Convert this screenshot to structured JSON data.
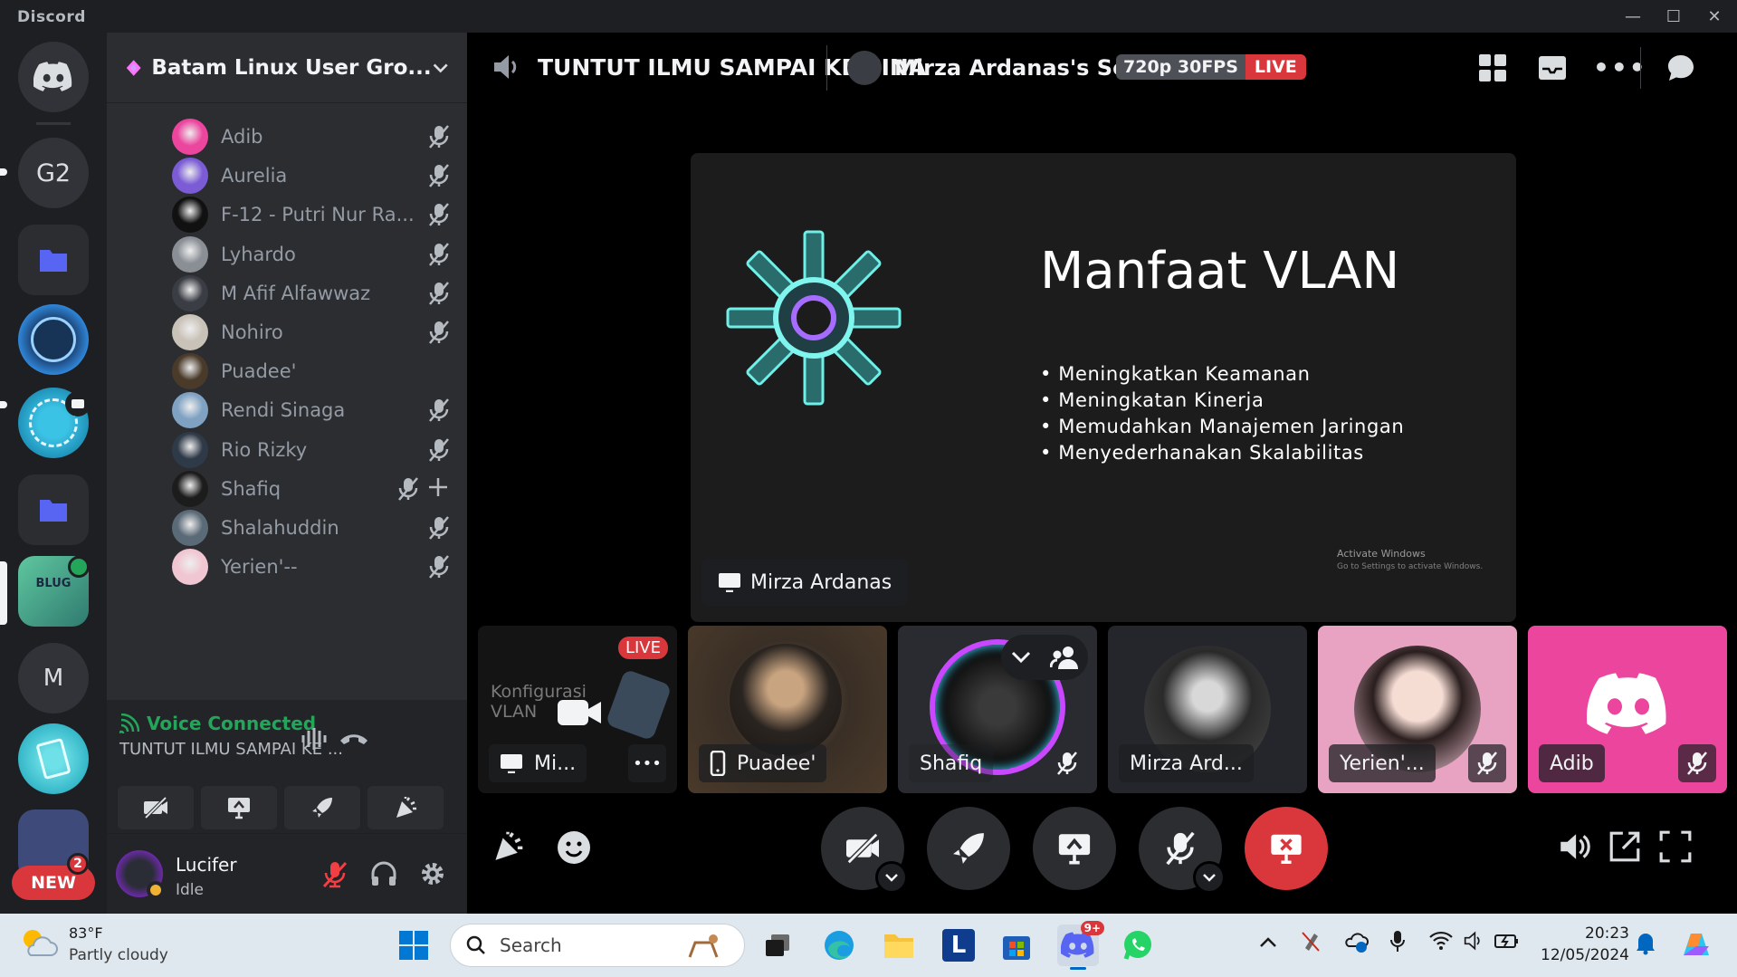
{
  "window": {
    "brand": "Discord"
  },
  "servers": [
    {
      "label": "G2"
    },
    {
      "label": "M"
    }
  ],
  "server_badge": {
    "label": "NEW",
    "count": "2"
  },
  "guild": {
    "name": "Batam Linux User Gro..."
  },
  "members": [
    {
      "name": "Adib",
      "muted": true,
      "avatar_color": "#eb459e"
    },
    {
      "name": "Aurelia",
      "muted": true,
      "avatar_color": "#7b5cd6"
    },
    {
      "name": "F-12 - Putri Nur Ra...",
      "muted": true,
      "avatar_color": "#111111"
    },
    {
      "name": "Lyhardo",
      "muted": true,
      "avatar_color": "#8a8f96"
    },
    {
      "name": "M Afif Alfawwaz",
      "muted": true,
      "avatar_color": "#3a3d44"
    },
    {
      "name": "Nohiro",
      "muted": true,
      "avatar_color": "#c9c2b8"
    },
    {
      "name": "Puadee'",
      "muted": false,
      "avatar_color": "#4a3a2a"
    },
    {
      "name": "Rendi Sinaga",
      "muted": true,
      "avatar_color": "#7fa2c2"
    },
    {
      "name": "Rio Rizky",
      "muted": true,
      "avatar_color": "#2f3a48"
    },
    {
      "name": "Shafiq",
      "muted": true,
      "avatar_color": "#1c1c1c"
    },
    {
      "name": "Shalahuddin",
      "muted": true,
      "avatar_color": "#5b6a77"
    },
    {
      "name": "Yerien'--",
      "muted": true,
      "avatar_color": "#f0c6d2"
    }
  ],
  "voice": {
    "status": "Voice Connected",
    "channel": "TUNTUT ILMU SAMPAI KE ..."
  },
  "user": {
    "name": "Lucifer",
    "status": "Idle"
  },
  "stage": {
    "channel_title": "TUNTUT ILMU SAMPAI KE CINA",
    "screen_title": "Mirza Ardanas's Screen",
    "quality": "720p 30FPS",
    "live": "LIVE"
  },
  "slide": {
    "title": "Manfaat VLAN",
    "bullets": [
      "Meningkatkan Keamanan",
      "Meningkatan Kinerja",
      "Memudahkan Manajemen Jaringan",
      "Menyederhanakan Skalabilitas"
    ],
    "activate": "Activate Windows",
    "activate_sub": "Go to Settings to activate Windows.",
    "presenter": "Mirza Ardanas"
  },
  "tiles": [
    {
      "name": "Mi...",
      "live": "LIVE",
      "bg_text": "Konfigurasi VLAN"
    },
    {
      "name": "Puadee'"
    },
    {
      "name": "Shafiq"
    },
    {
      "name": "Mirza Ard..."
    },
    {
      "name": "Yerien'..."
    },
    {
      "name": "Adib"
    }
  ],
  "taskbar": {
    "weather_temp": "83°F",
    "weather_desc": "Partly cloudy",
    "search_placeholder": "Search",
    "discord_badge": "9+",
    "time": "20:23",
    "date": "12/05/2024"
  },
  "colors": {
    "accent": "#5865f2",
    "danger": "#da373c",
    "online": "#23a55a"
  }
}
